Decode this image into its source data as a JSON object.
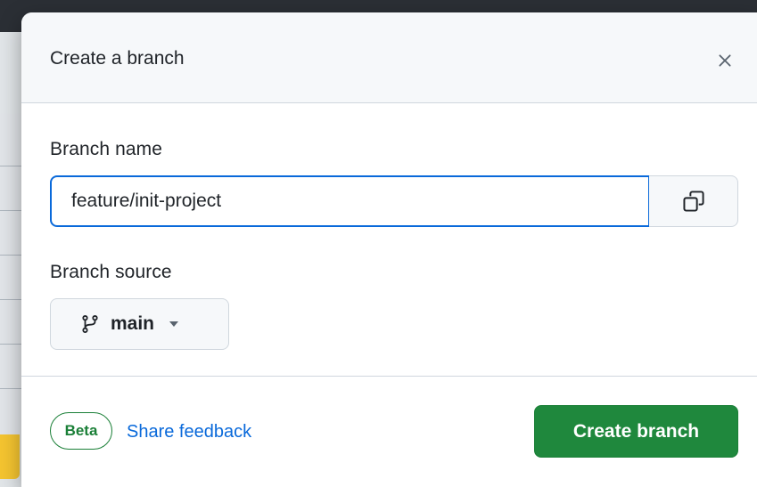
{
  "dialog": {
    "title": "Create a branch",
    "close_icon": "close-icon"
  },
  "branch_name": {
    "label": "Branch name",
    "value": "feature/init-project",
    "copy_icon": "copy-icon"
  },
  "branch_source": {
    "label": "Branch source",
    "selected": "main",
    "branch_icon": "git-branch-icon",
    "caret_icon": "triangle-down-icon"
  },
  "footer": {
    "badge": "Beta",
    "feedback_link": "Share feedback",
    "create_button": "Create branch"
  },
  "colors": {
    "primary_button": "#1f883d",
    "accent_blue": "#0969da",
    "beta_green": "#1a7f37"
  }
}
